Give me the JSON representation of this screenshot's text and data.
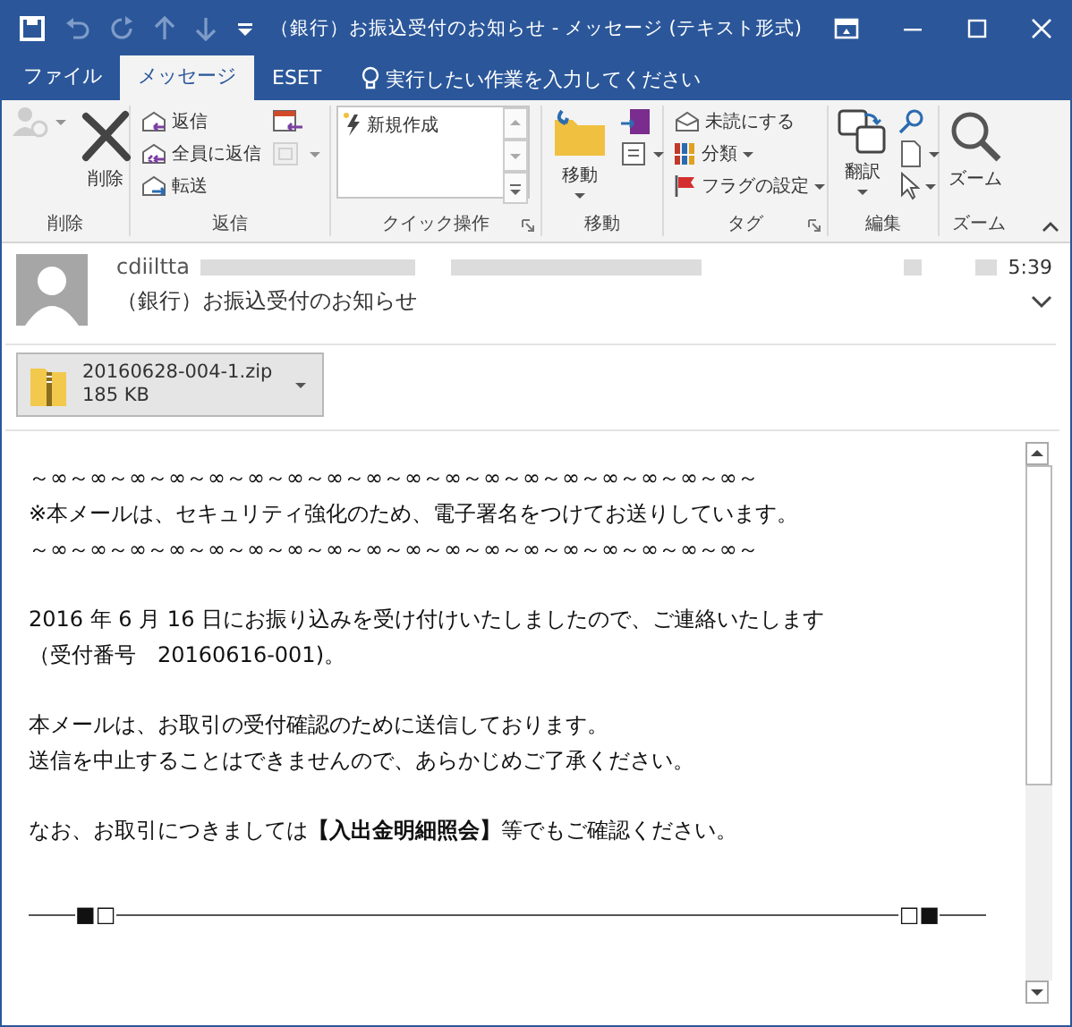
{
  "window": {
    "title": "（銀行）お振込受付のお知らせ - メッセージ (テキスト形式)"
  },
  "tabs": [
    {
      "label": "ファイル",
      "selected": false
    },
    {
      "label": "メッセージ",
      "selected": true
    },
    {
      "label": "ESET",
      "selected": false
    }
  ],
  "tell_me": {
    "placeholder": "実行したい作業を入力してください"
  },
  "ribbon": {
    "groups": [
      {
        "label": "削除",
        "launcher": false,
        "columns": [
          [
            {
              "kind": "icon",
              "disabled": true,
              "dropdown": true
            }
          ],
          [
            {
              "kind": "large",
              "label": "削除",
              "dropdown": false
            }
          ]
        ]
      },
      {
        "label": "返信",
        "launcher": false,
        "columns": [
          [
            {
              "kind": "small",
              "label": "返信",
              "dropdown": false
            },
            {
              "kind": "small",
              "label": "全員に返信",
              "dropdown": false
            },
            {
              "kind": "small",
              "label": "転送",
              "dropdown": false
            }
          ],
          [
            {
              "kind": "icon",
              "disabled": false,
              "dropdown": false
            },
            {
              "kind": "icon",
              "disabled": true,
              "dropdown": true
            }
          ]
        ]
      },
      {
        "label": "クイック操作",
        "launcher": true,
        "columns": [
          [
            {
              "kind": "gallery",
              "label": "新規作成"
            }
          ]
        ]
      },
      {
        "label": "移動",
        "launcher": false,
        "columns": [
          [
            {
              "kind": "large",
              "label": "移動",
              "dropdown": true
            }
          ],
          [
            {
              "kind": "icon",
              "disabled": false,
              "dropdown": false
            },
            {
              "kind": "icon",
              "disabled": false,
              "dropdown": true
            }
          ]
        ]
      },
      {
        "label": "タグ",
        "launcher": true,
        "columns": [
          [
            {
              "kind": "small",
              "label": "未読にする",
              "dropdown": false
            },
            {
              "kind": "small",
              "label": "分類",
              "dropdown": true
            },
            {
              "kind": "small",
              "label": "フラグの設定",
              "dropdown": true
            }
          ]
        ]
      },
      {
        "label": "編集",
        "launcher": false,
        "columns": [
          [
            {
              "kind": "large",
              "label": "翻訳",
              "dropdown": true
            }
          ],
          [
            {
              "kind": "icon",
              "disabled": false,
              "dropdown": false
            },
            {
              "kind": "icon",
              "disabled": false,
              "dropdown": true
            },
            {
              "kind": "icon",
              "disabled": false,
              "dropdown": true
            }
          ]
        ]
      },
      {
        "label": "ズーム",
        "launcher": false,
        "columns": [
          [
            {
              "kind": "large",
              "label": "ズーム",
              "dropdown": false
            }
          ]
        ]
      }
    ]
  },
  "header": {
    "sender": "cdiiltta",
    "time": "5:39",
    "subject": "（銀行）お振込受付のお知らせ"
  },
  "attachment": {
    "name": "20160628-004-1.zip",
    "size": "185 KB"
  },
  "body": {
    "paragraphs": [
      [
        "～∞～∞～∞～∞～∞～∞～∞～∞～∞～∞～∞～∞～∞～∞～∞～∞～∞～∞～",
        "※本メールは、セキュリティ強化のため、電子署名をつけてお送りしています。",
        "～∞～∞～∞～∞～∞～∞～∞～∞～∞～∞～∞～∞～∞～∞～∞～∞～∞～∞～"
      ],
      [
        "2016 年 6 月 16 日にお振り込みを受け付けいたしましたので、ご連絡いたします",
        "（受付番号　20160616-001)。"
      ],
      [
        "本メールは、お取引の受付確認のために送信しております。",
        "送信を中止することはできませんので、あらかじめご了承ください。"
      ],
      [
        "なお、お取引につきましては**【入出金明細照会】**等でもご確認ください。"
      ]
    ],
    "divider": {
      "left_mark": "■□",
      "right_mark": "□■"
    }
  }
}
